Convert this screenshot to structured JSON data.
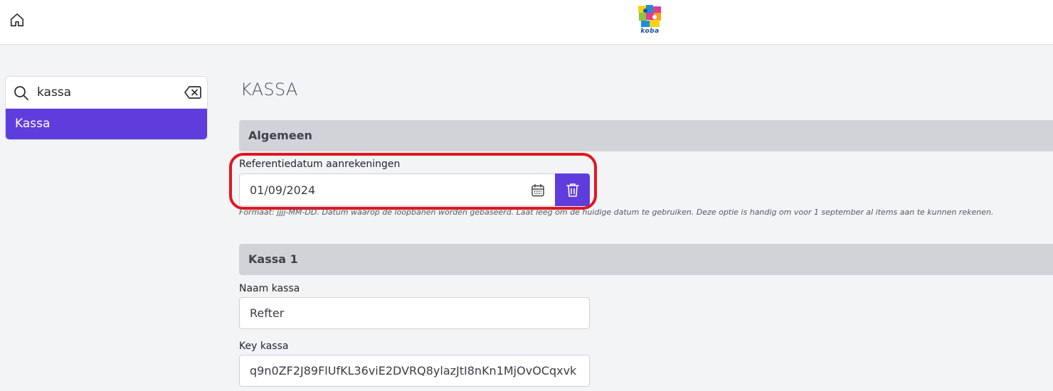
{
  "header": {
    "home_icon": "home-icon",
    "logo_text": "koba"
  },
  "sidebar": {
    "search": {
      "value": "kassa",
      "icon": "search-icon",
      "clear_icon": "backspace-icon"
    },
    "items": [
      {
        "label": "Kassa",
        "active": true
      }
    ]
  },
  "main": {
    "title": "KASSA",
    "sections": [
      {
        "title": "Algemeen",
        "fields": [
          {
            "label": "Referentiedatum aanrekeningen",
            "value": "01/09/2024",
            "calendar_icon": "calendar-icon",
            "delete_icon": "trash-icon",
            "help": "Formaat: jjjj-MM-DD. Datum waarop de loopbanen worden gebaseerd. Laat leeg om de huidige datum te gebruiken. Deze optie is handig om voor 1 september al items aan te kunnen rekenen."
          }
        ]
      },
      {
        "title": "Kassa 1",
        "fields": [
          {
            "label": "Naam kassa",
            "value": "Refter"
          },
          {
            "label": "Key kassa",
            "value": "q9n0ZF2J89FlUfKL36viE2DVRQ8ylazJtI8nKn1MjOvOCqxvk"
          }
        ]
      }
    ]
  },
  "colors": {
    "accent": "#5f3ddd",
    "highlight": "#e0161e",
    "section_bg": "#d1d3d9",
    "page_bg": "#f3f4f6"
  }
}
